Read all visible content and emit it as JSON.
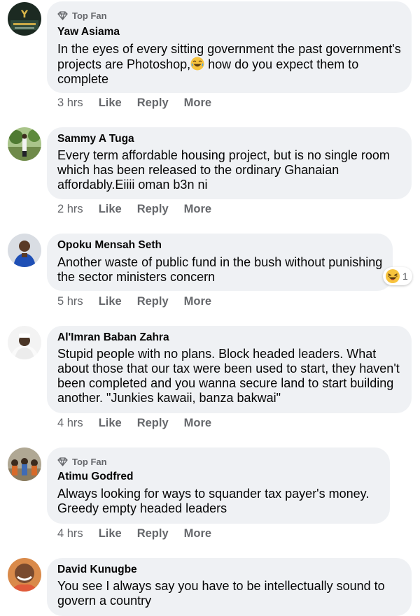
{
  "comments": [
    {
      "badge": "Top Fan",
      "author": "Yaw Asiama",
      "text_before": "In the eyes of every sitting government the past government's projects are Photoshop,",
      "text_after": " how do you expect them to complete",
      "emoji": "crying-laughing-emoji",
      "time": "3 hrs",
      "like": "Like",
      "reply": "Reply",
      "more": "More"
    },
    {
      "author": "Sammy A Tuga",
      "text": "Every term affordable housing project, but is no single room which has been released to the ordinary Ghanaian affordably.Eiiii oman b3n ni",
      "time": "2 hrs",
      "like": "Like",
      "reply": "Reply",
      "more": "More"
    },
    {
      "author": "Opoku Mensah Seth",
      "text": "Another waste of public fund in the bush without punishing the sector ministers concern",
      "reaction_icon": "laughing-emoji",
      "reaction_count": "1",
      "time": "5 hrs",
      "like": "Like",
      "reply": "Reply",
      "more": "More"
    },
    {
      "author": "Al'Imran Baban Zahra",
      "text": "Stupid people with no plans. Block headed leaders. What about those that our tax were been used to start, they haven't been completed and you wanna secure land to start building another. \"Junkies kawaii, banza bakwai\"",
      "time": "4 hrs",
      "like": "Like",
      "reply": "Reply",
      "more": "More"
    },
    {
      "badge": "Top Fan",
      "author": "Atimu Godfred",
      "text": "Always looking for ways to squander tax payer's money. Greedy empty headed leaders",
      "time": "4 hrs",
      "like": "Like",
      "reply": "Reply",
      "more": "More"
    },
    {
      "author": "David Kunugbe",
      "text": "You see I always say you have to be intellectually sound to govern a country"
    }
  ],
  "colors": {
    "bubble": "#eff1f4",
    "meta_text": "#65676b",
    "name_text": "#050505"
  }
}
